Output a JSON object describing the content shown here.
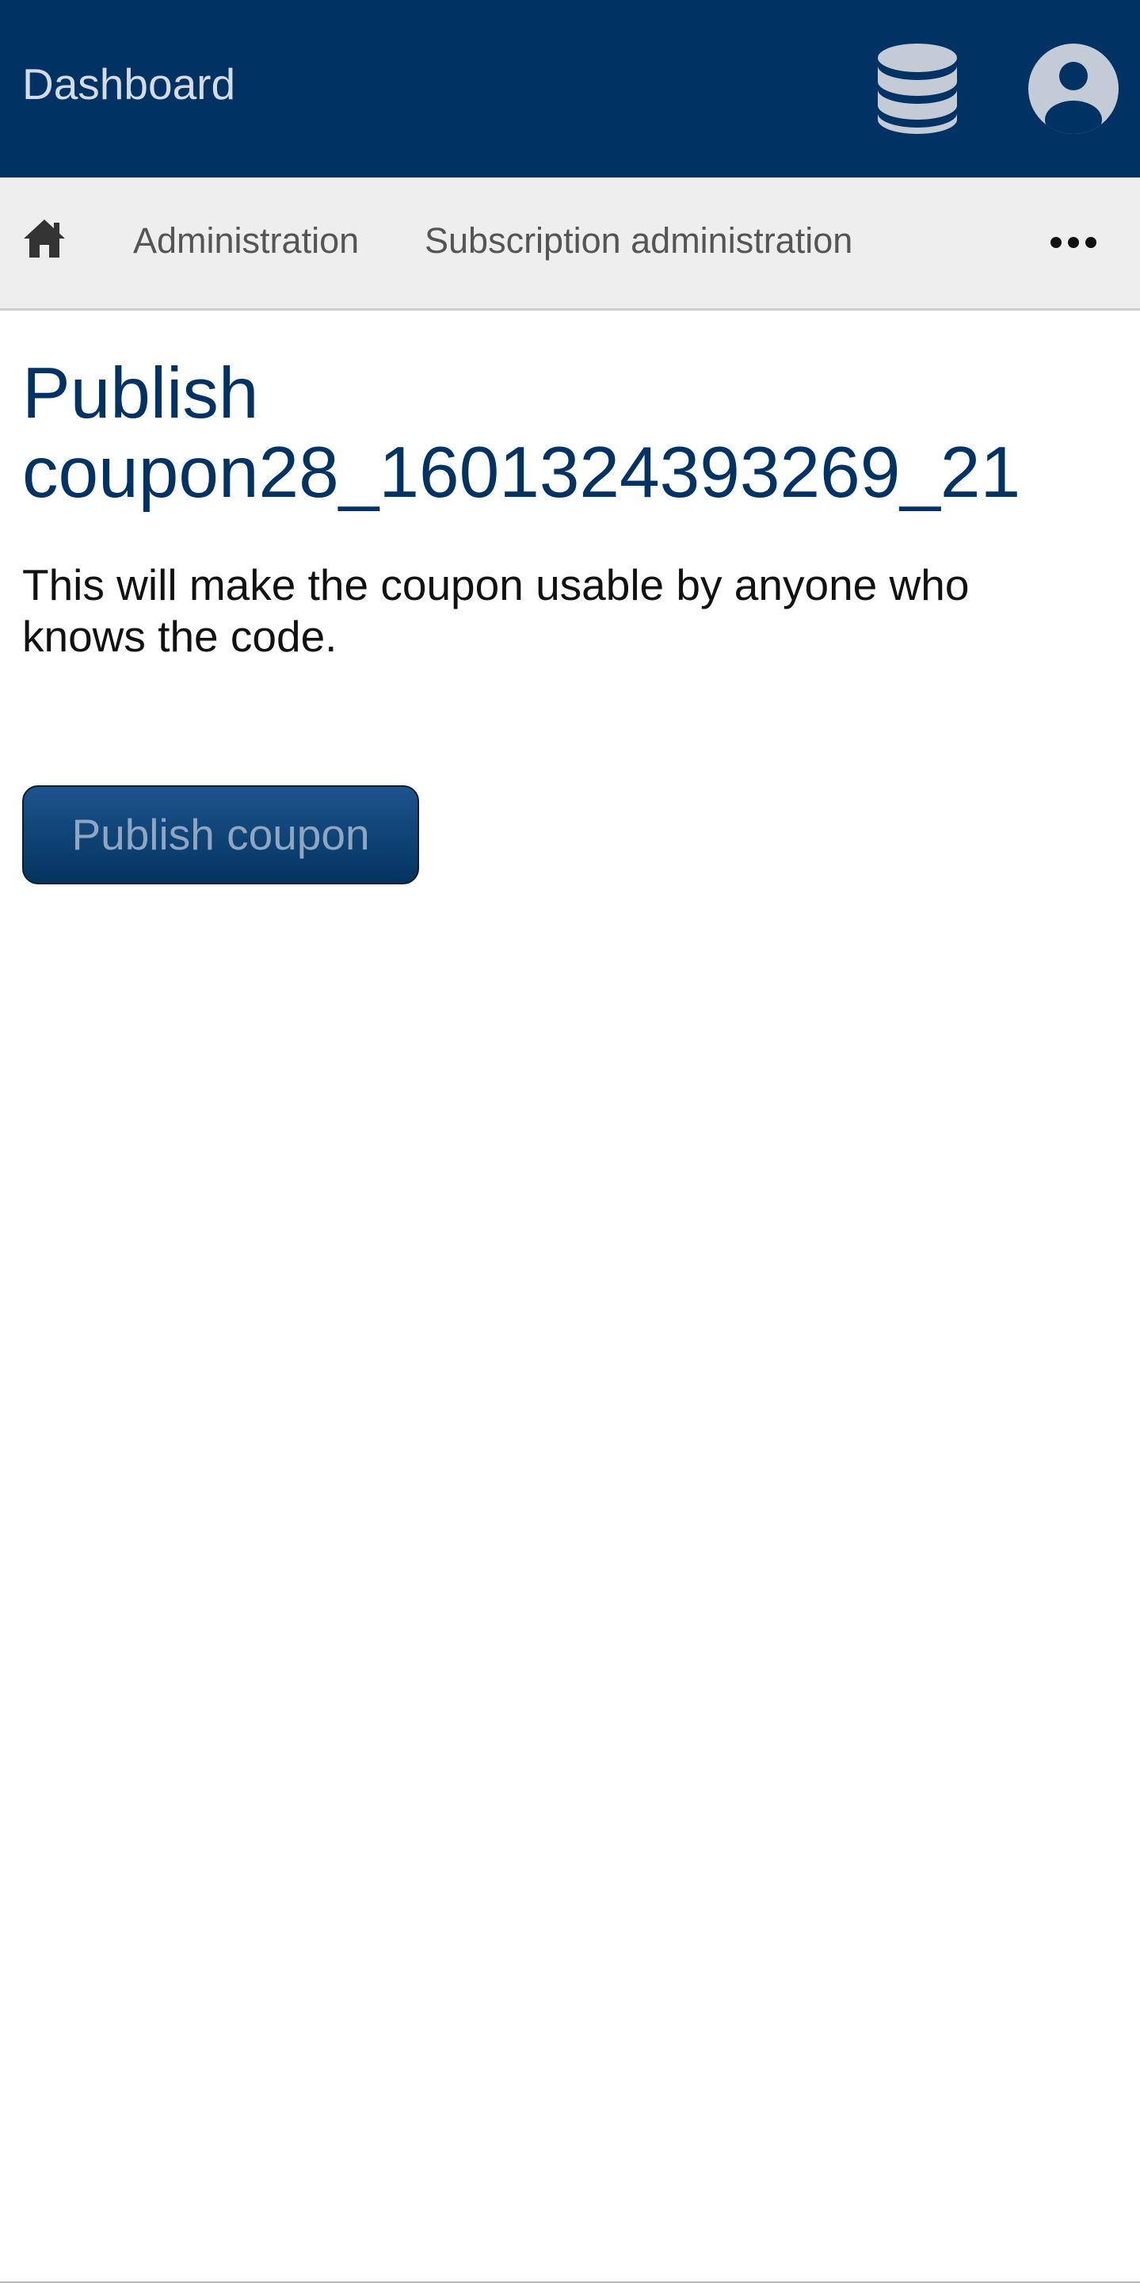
{
  "header": {
    "title": "Dashboard",
    "icons": [
      "database-icon",
      "user-account-icon"
    ]
  },
  "breadcrumb": {
    "home_icon": "home-icon",
    "items": [
      {
        "label": "Administration"
      },
      {
        "label": "Subscription administration"
      }
    ],
    "more_icon": "more-horizontal-icon"
  },
  "main": {
    "title": "Publish coupon28_1601324393269_21",
    "description": "This will make the coupon usable by anyone who knows the code.",
    "publish_button_label": "Publish coupon"
  },
  "colors": {
    "header_bg": "#003263",
    "breadcrumb_bg": "#eeeeee",
    "heading_text": "#003263",
    "button_bg": "#1d548e"
  }
}
